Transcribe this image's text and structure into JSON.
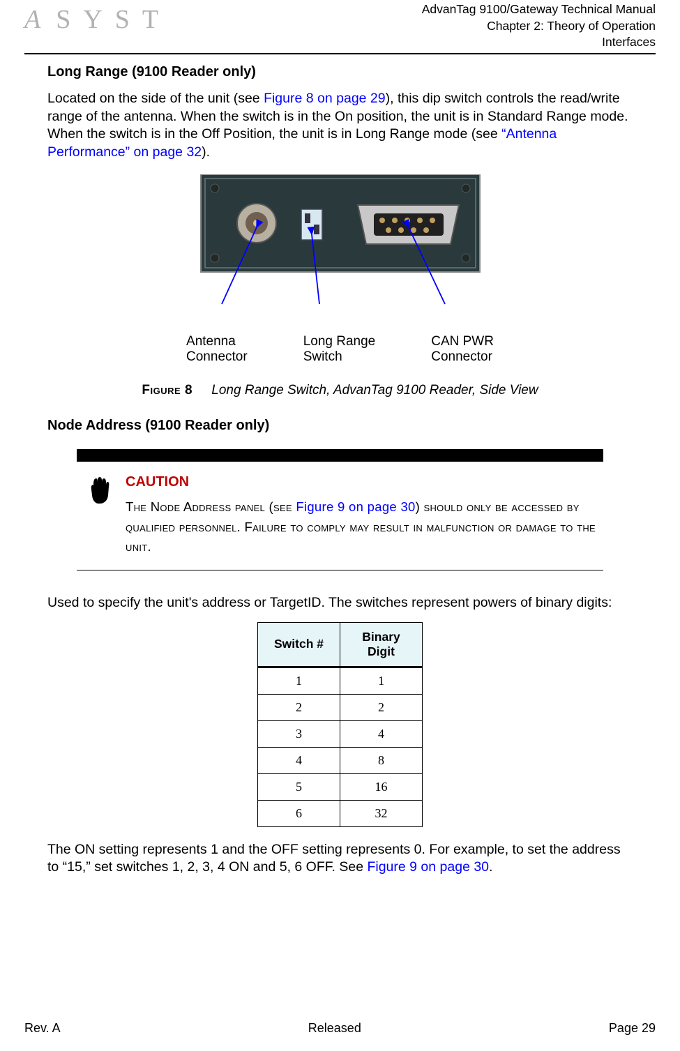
{
  "header": {
    "line1": "AdvanTag 9100/Gateway Technical Manual",
    "line2": "Chapter 2: Theory of Operation",
    "line3": "Interfaces"
  },
  "sec1": {
    "title": "Long Range (9100 Reader only)",
    "p_a": "Located on the side of the unit (see ",
    "xref1": "Figure 8 on page 29",
    "p_b": "), this dip switch controls the read/write range of the antenna. When the switch is in the On position, the unit is in Standard Range mode. When the switch is in the Off Position, the unit is in Long Range mode (see ",
    "xref2": "“Antenna Performance” on page 32",
    "p_c": ")."
  },
  "figure8": {
    "callout1_l1": "Antenna",
    "callout1_l2": "Connector",
    "callout2_l1": "Long Range",
    "callout2_l2": "Switch",
    "callout3_l1": "CAN PWR",
    "callout3_l2": "Connector",
    "label": "Figure 8",
    "title": "Long Range Switch, AdvanTag 9100 Reader, Side View"
  },
  "sec2": {
    "title": "Node Address (9100 Reader only)"
  },
  "caution": {
    "title": "CAUTION",
    "l1a": "The Node Address panel (see ",
    "xref": "Figure 9 on page 30",
    "l1b": ") should only be accessed by qualified personnel. Failure to comply may result in malfunction or damage to the unit."
  },
  "sec3": {
    "p1": "Used to specify the unit's address or TargetID. The switches represent powers of binary digits:",
    "p2a": "The ON setting represents 1 and the OFF setting represents 0. For example, to set the address to “15,” set switches 1, 2, 3, 4 ON and 5, 6 OFF. See ",
    "xref": "Figure 9 on page 30",
    "p2b": "."
  },
  "table": {
    "h1": "Switch #",
    "h2": "Binary Digit",
    "rows": [
      {
        "a": "1",
        "b": "1"
      },
      {
        "a": "2",
        "b": "2"
      },
      {
        "a": "3",
        "b": "4"
      },
      {
        "a": "4",
        "b": "8"
      },
      {
        "a": "5",
        "b": "16"
      },
      {
        "a": "6",
        "b": "32"
      }
    ]
  },
  "footer": {
    "left": "Rev. A",
    "center": "Released",
    "right": "Page 29"
  }
}
